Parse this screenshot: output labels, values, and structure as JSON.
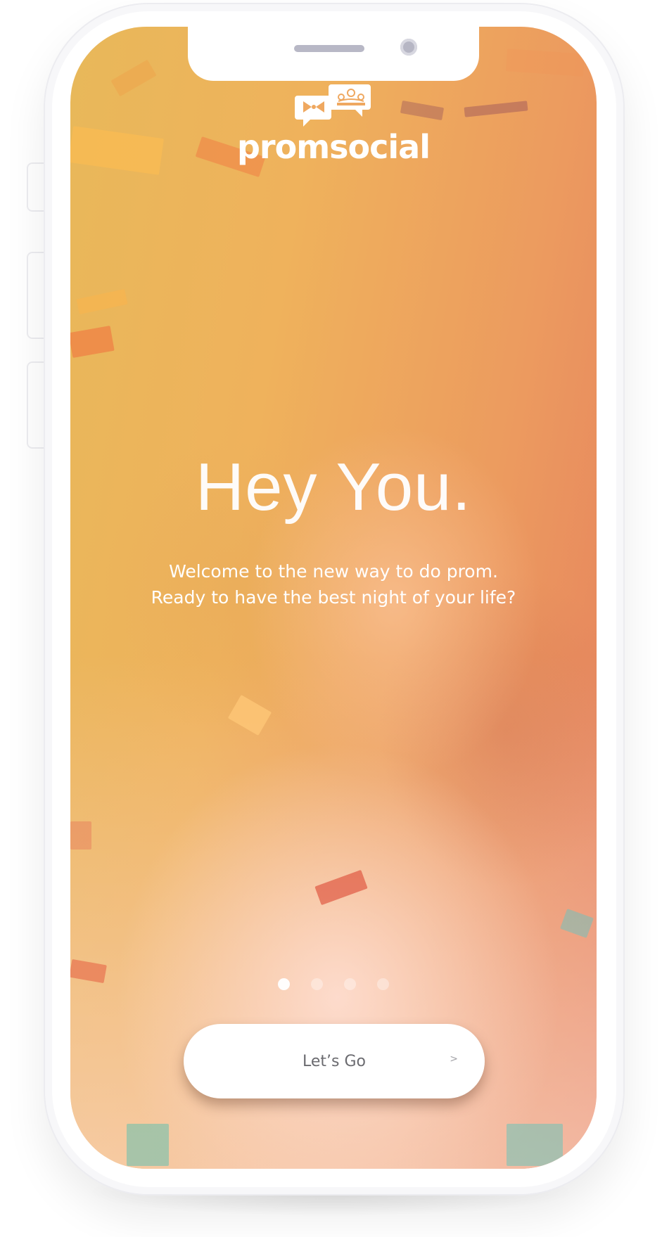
{
  "app": {
    "brand_name": "promsocial"
  },
  "onboarding": {
    "headline": "Hey You.",
    "subtitle_line1": "Welcome to the new way to do prom.",
    "subtitle_line2": "Ready to have the best night of your life?",
    "pager": {
      "total": 4,
      "active_index": 0
    },
    "cta_label": "Let’s Go",
    "cta_chevron": ">"
  },
  "icons": {
    "logo_left": "bowtie-speech-bubble-icon",
    "logo_right": "tiara-speech-bubble-icon",
    "cta": "chevron-right-icon"
  },
  "colors": {
    "gradient_start": "#e8b85a",
    "gradient_end": "#e57f5e",
    "button_bg": "#ffffff",
    "button_text": "#6b6b70"
  }
}
